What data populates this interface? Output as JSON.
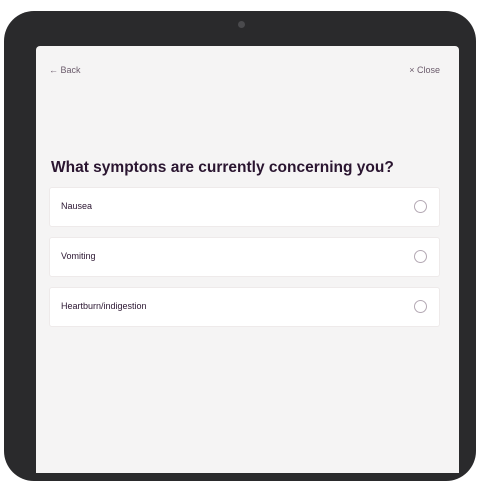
{
  "nav": {
    "back_label": "← Back",
    "close_label": "× Close"
  },
  "question": "What symptons are currently concerning you?",
  "options": [
    {
      "label": "Nausea",
      "selected": false
    },
    {
      "label": "Vomiting",
      "selected": false
    },
    {
      "label": "Heartburn/indigestion",
      "selected": false
    }
  ],
  "colors": {
    "device": "#2a2a2c",
    "screen_bg": "#f5f4f4",
    "text_dark": "#2a1530",
    "nav_text": "#6b5b6b"
  },
  "icons": {
    "option_control": "radio-circle-icon"
  }
}
